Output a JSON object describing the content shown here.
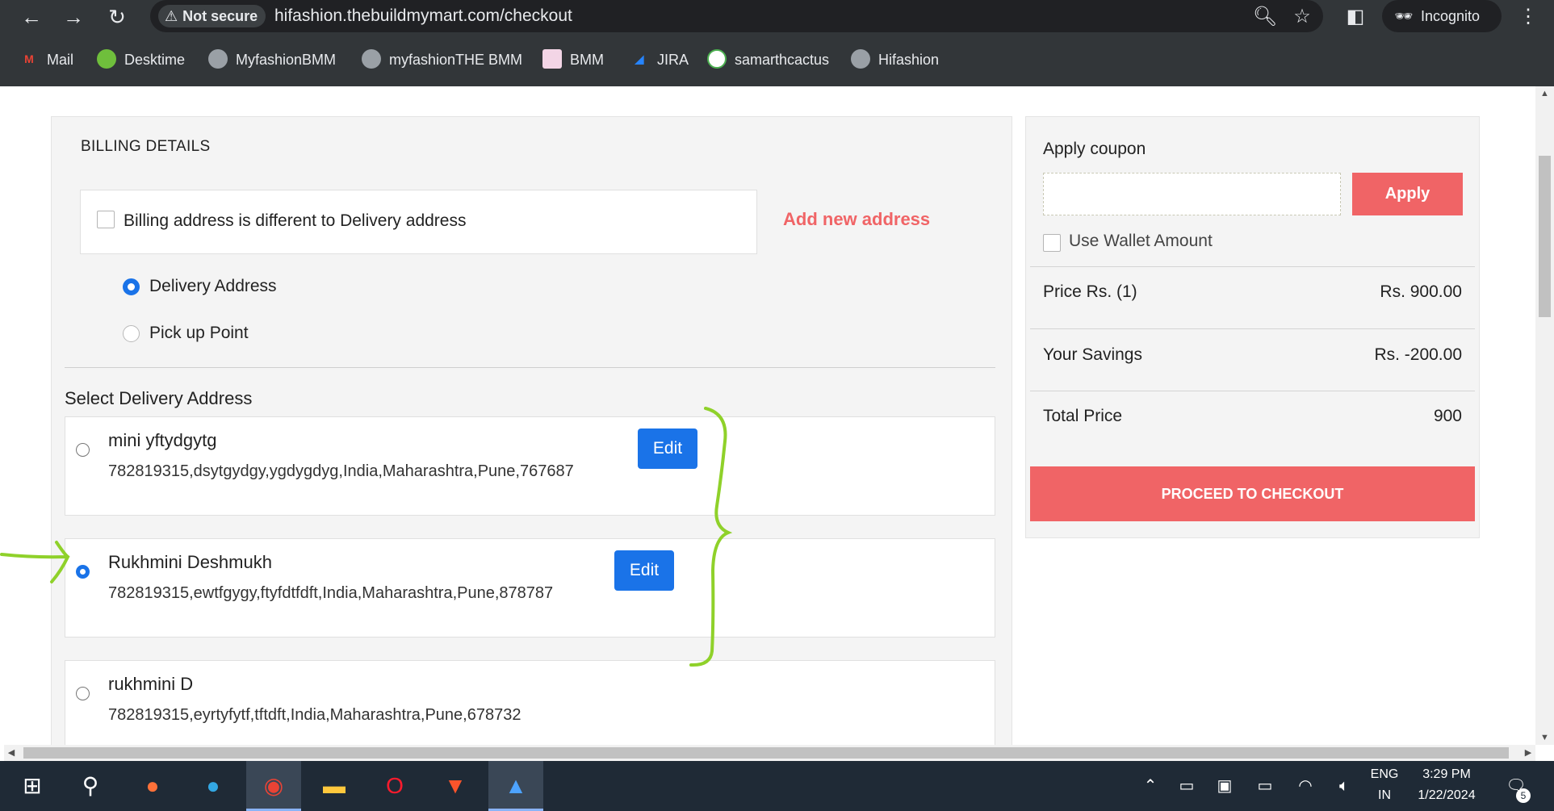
{
  "browser": {
    "back_icon": "back-arrow-icon",
    "forward_icon": "forward-arrow-icon",
    "reload_icon": "reload-icon",
    "security_label": "Not secure",
    "url": "hifashion.thebuildmymart.com/checkout",
    "incognito_label": "Incognito",
    "bookmarks": [
      {
        "label": "Mail",
        "icon": "gmail-icon",
        "color": "#ea4335"
      },
      {
        "label": "Desktime",
        "icon": "desktime-icon",
        "color": "#6fbf3c"
      },
      {
        "label": "MyfashionBMM",
        "icon": "globe-icon",
        "color": "#9aa0a6"
      },
      {
        "label": "myfashionTHE BMM",
        "icon": "globe-icon",
        "color": "#9aa0a6"
      },
      {
        "label": "BMM",
        "icon": "bmm-icon",
        "color": "#d24f9c"
      },
      {
        "label": "JIRA",
        "icon": "jira-icon",
        "color": "#2684ff"
      },
      {
        "label": "samarthcactus",
        "icon": "cactus-icon",
        "color": "#4caf50"
      },
      {
        "label": "Hifashion",
        "icon": "globe-icon",
        "color": "#9aa0a6"
      }
    ]
  },
  "billing": {
    "title": "BILLING DETAILS",
    "different_address_label": "Billing address is different to Delivery address",
    "add_new_address": "Add new address",
    "delivery_option": "Delivery Address",
    "pickup_option": "Pick up Point",
    "selected_option": "Delivery Address",
    "select_title": "Select Delivery Address",
    "edit_label": "Edit",
    "addresses": [
      {
        "name": "mini yftydgytg",
        "line": "782819315,dsytgydgy,ygdygdyg,India,Maharashtra,Pune,767687",
        "selected": false
      },
      {
        "name": "Rukhmini Deshmukh",
        "line": "782819315,ewtfgygy,ftyfdtfdft,India,Maharashtra,Pune,878787",
        "selected": true
      },
      {
        "name": "rukhmini D",
        "line": "782819315,eyrtyfytf,tftdft,India,Maharashtra,Pune,678732",
        "selected": false
      }
    ]
  },
  "summary": {
    "coupon_title": "Apply coupon",
    "coupon_value": "",
    "apply_label": "Apply",
    "wallet_label": "Use Wallet Amount",
    "price_label": "Price Rs. (1)",
    "price_value": "Rs. 900.00",
    "savings_label": "Your Savings",
    "savings_value": "Rs. -200.00",
    "total_label": "Total Price",
    "total_value": "900",
    "checkout_label": "PROCEED TO CHECKOUT",
    "accent_color": "#f06466"
  },
  "taskbar": {
    "apps": [
      "windows-start-icon",
      "search-icon",
      "firefox-icon",
      "edge-icon",
      "chrome-icon",
      "file-explorer-icon",
      "opera-icon",
      "brave-icon",
      "photos-icon"
    ],
    "language": "ENG",
    "region": "IN",
    "time": "3:29 PM",
    "date": "1/22/2024",
    "notifications": "5"
  }
}
